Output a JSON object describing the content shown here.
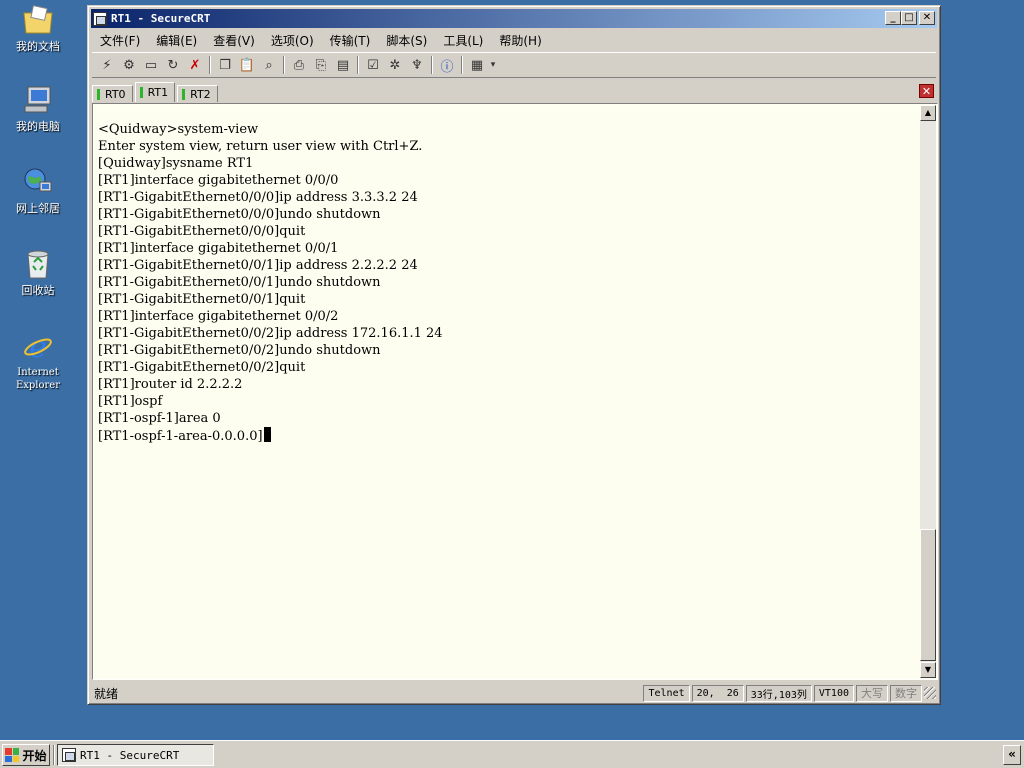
{
  "desktop": {
    "icons": [
      {
        "label": "我的文档"
      },
      {
        "label": "我的电脑"
      },
      {
        "label": "网上邻居"
      },
      {
        "label": "回收站"
      },
      {
        "label": "Internet Explorer"
      }
    ]
  },
  "window": {
    "title": "RT1 - SecureCRT",
    "buttons": {
      "minimize": "_",
      "maximize": "□",
      "close": "✕"
    }
  },
  "menu": [
    {
      "label": "文件(F)"
    },
    {
      "label": "编辑(E)"
    },
    {
      "label": "查看(V)"
    },
    {
      "label": "选项(O)"
    },
    {
      "label": "传输(T)"
    },
    {
      "label": "脚本(S)"
    },
    {
      "label": "工具(L)"
    },
    {
      "label": "帮助(H)"
    }
  ],
  "toolbar": {
    "icons": [
      "connect-icon",
      "quick-connect-icon",
      "connect-tab-icon",
      "reconnect-icon",
      "disconnect-icon",
      "copy-icon",
      "paste-icon",
      "find-icon",
      "print-icon",
      "print-selection-icon",
      "print-setup-icon",
      "session-options-icon",
      "global-options-icon",
      "keymap-icon",
      "help-icon",
      "sftp-icon",
      "more-icon"
    ]
  },
  "tabs": [
    {
      "label": "RT0",
      "active": false
    },
    {
      "label": "RT1",
      "active": true
    },
    {
      "label": "RT2",
      "active": false
    }
  ],
  "terminal": {
    "lines": [
      "<Quidway>system-view",
      "Enter system view, return user view with Ctrl+Z.",
      "[Quidway]sysname RT1",
      "[RT1]interface gigabitethernet 0/0/0",
      "[RT1-GigabitEthernet0/0/0]ip address 3.3.3.2 24",
      "[RT1-GigabitEthernet0/0/0]undo shutdown",
      "[RT1-GigabitEthernet0/0/0]quit",
      "[RT1]interface gigabitethernet 0/0/1",
      "[RT1-GigabitEthernet0/0/1]ip address 2.2.2.2 24",
      "[RT1-GigabitEthernet0/0/1]undo shutdown",
      "[RT1-GigabitEthernet0/0/1]quit",
      "[RT1]interface gigabitethernet 0/0/2",
      "[RT1-GigabitEthernet0/0/2]ip address 172.16.1.1 24",
      "[RT1-GigabitEthernet0/0/2]undo shutdown",
      "[RT1-GigabitEthernet0/0/2]quit",
      "[RT1]router id 2.2.2.2",
      "[RT1]ospf",
      "[RT1-ospf-1]area 0",
      "[RT1-ospf-1-area-0.0.0.0]"
    ]
  },
  "statusbar": {
    "ready": "就绪",
    "protocol": "Telnet",
    "position": "20,  26",
    "size": "33行,103列",
    "emulation": "VT100",
    "caps": "大写",
    "num": "数字"
  },
  "taskbar": {
    "start_label": "开始",
    "task_label": "RT1 - SecureCRT",
    "tray_label": "«"
  }
}
